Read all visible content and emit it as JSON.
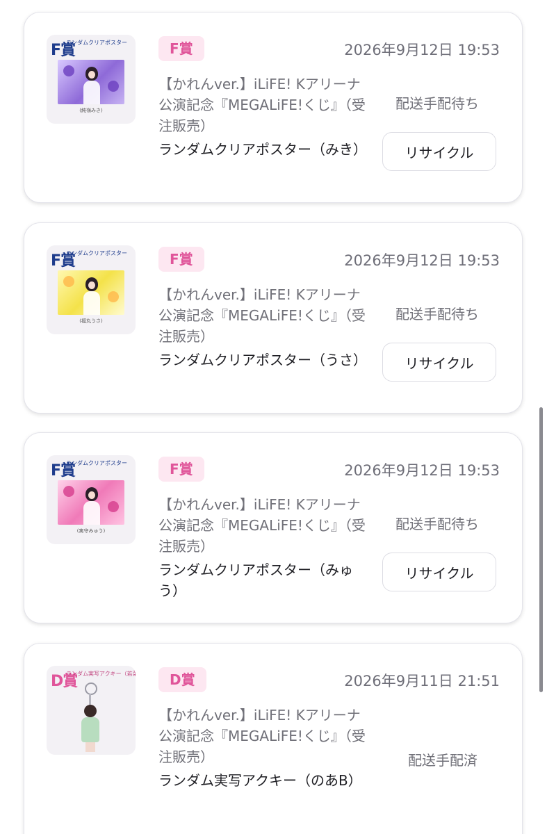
{
  "colors": {
    "badge_bg": "#fde7f1",
    "badge_text": "#e0559a",
    "scrollbar": "#8a8a90"
  },
  "orders": [
    {
      "thumbnail": {
        "grade": "F賞",
        "title": "ランダムクリアポスター",
        "caption": "(純嶺みき)",
        "theme": "purple"
      },
      "badge": "F賞",
      "datetime": "2026年9月12日 19:53",
      "series": "【かれんver.】iLiFE! Kアリーナ公演記念『MEGALiFE!くじ』（受注販売）",
      "item": "ランダムクリアポスター（みき）",
      "status": "配送手配待ち",
      "button": "リサイクル"
    },
    {
      "thumbnail": {
        "grade": "F賞",
        "title": "ランダムクリアポスター",
        "caption": "(福丸うさ)",
        "theme": "yellow"
      },
      "badge": "F賞",
      "datetime": "2026年9月12日 19:53",
      "series": "【かれんver.】iLiFE! Kアリーナ公演記念『MEGALiFE!くじ』（受注販売）",
      "item": "ランダムクリアポスター（うさ）",
      "status": "配送手配待ち",
      "button": "リサイクル"
    },
    {
      "thumbnail": {
        "grade": "F賞",
        "title": "ランダムクリアポスター",
        "caption": "(実守みゅう)",
        "theme": "pink"
      },
      "badge": "F賞",
      "datetime": "2026年9月12日 19:53",
      "series": "【かれんver.】iLiFE! Kアリーナ公演記念『MEGALiFE!くじ』（受注販売）",
      "item": "ランダムクリアポスター（みゅう）",
      "status": "配送手配待ち",
      "button": "リサイクル"
    },
    {
      "thumbnail": {
        "grade": "D賞",
        "title": "ランダム実写アクキー（若菜のあ B）",
        "theme": "acrylic"
      },
      "badge": "D賞",
      "datetime": "2026年9月11日 21:51",
      "series": "【かれんver.】iLiFE! Kアリーナ公演記念『MEGALiFE!くじ』（受注販売）",
      "item": "ランダム実写アクキー（のあB）",
      "status": "配送手配済"
    }
  ]
}
